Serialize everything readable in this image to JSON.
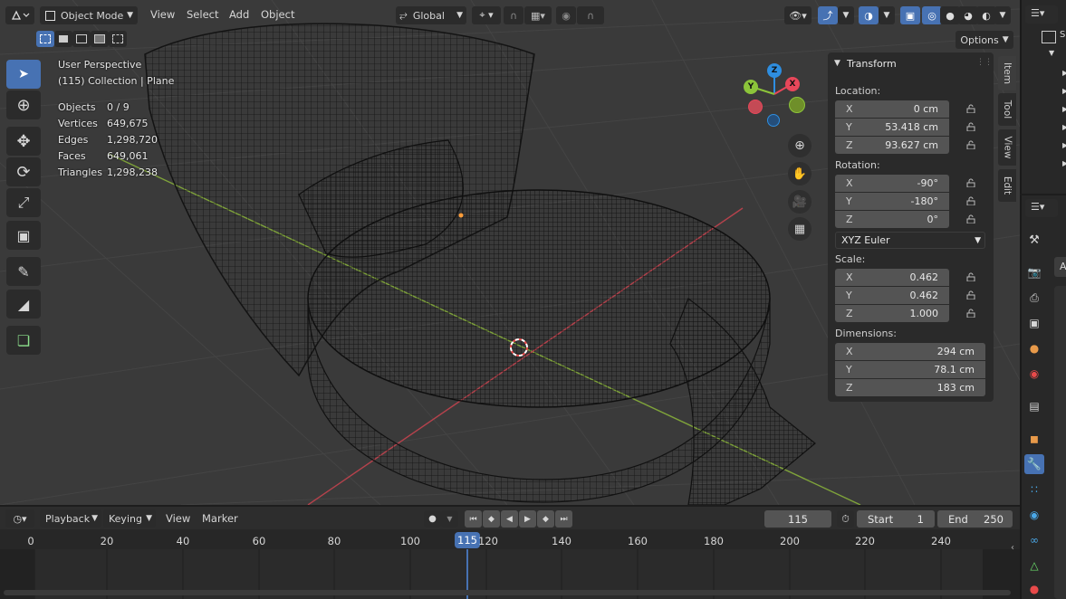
{
  "header": {
    "mode": "Object Mode",
    "menus": [
      "View",
      "Select",
      "Add",
      "Object"
    ],
    "orientation": "Global",
    "options_label": "Options"
  },
  "overlay": {
    "perspective": "User Perspective",
    "collection": "(115) Collection | Plane",
    "stats": [
      {
        "label": "Objects",
        "value": "0 / 9"
      },
      {
        "label": "Vertices",
        "value": "649,675"
      },
      {
        "label": "Edges",
        "value": "1,298,720"
      },
      {
        "label": "Faces",
        "value": "649,061"
      },
      {
        "label": "Triangles",
        "value": "1,298,238"
      }
    ]
  },
  "gizmo": {
    "x": "X",
    "y": "Y",
    "z": "Z"
  },
  "npanel": {
    "title": "Transform",
    "location_label": "Location:",
    "location": [
      {
        "ax": "X",
        "val": "0 cm"
      },
      {
        "ax": "Y",
        "val": "53.418 cm"
      },
      {
        "ax": "Z",
        "val": "93.627 cm"
      }
    ],
    "rotation_label": "Rotation:",
    "rotation": [
      {
        "ax": "X",
        "val": "-90°"
      },
      {
        "ax": "Y",
        "val": "-180°"
      },
      {
        "ax": "Z",
        "val": "0°"
      }
    ],
    "rotation_mode": "XYZ Euler",
    "scale_label": "Scale:",
    "scale": [
      {
        "ax": "X",
        "val": "0.462"
      },
      {
        "ax": "Y",
        "val": "0.462"
      },
      {
        "ax": "Z",
        "val": "1.000"
      }
    ],
    "dimensions_label": "Dimensions:",
    "dimensions": [
      {
        "ax": "X",
        "val": "294 cm"
      },
      {
        "ax": "Y",
        "val": "78.1 cm"
      },
      {
        "ax": "Z",
        "val": "183 cm"
      }
    ],
    "tabs": [
      "Item",
      "Tool",
      "View",
      "Edit"
    ]
  },
  "props_partial": {
    "field": "A"
  },
  "timeline": {
    "menus": [
      "Playback",
      "Keying",
      "View",
      "Marker"
    ],
    "current_frame": "115",
    "start_label": "Start",
    "start": "1",
    "end_label": "End",
    "end": "250",
    "ruler": [
      "0",
      "20",
      "40",
      "60",
      "80",
      "100",
      "115",
      "120",
      "140",
      "160",
      "180",
      "200",
      "220",
      "240"
    ]
  },
  "colors": {
    "accent": "#4772b3",
    "x_axis": "#e8475a",
    "y_axis": "#8cc43a",
    "z_axis": "#2e8ee0",
    "viewport_bg": "#3a3a3a"
  }
}
